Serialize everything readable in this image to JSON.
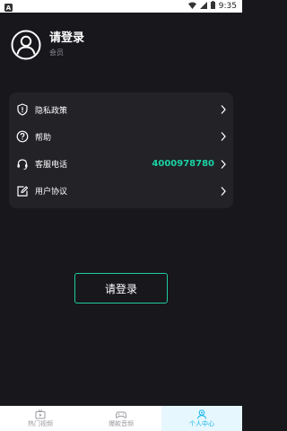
{
  "status_bar": {
    "time": "9:35",
    "app_icon": "a-icon",
    "icons": [
      "wifi-icon",
      "signal-icon",
      "battery-icon"
    ]
  },
  "profile": {
    "avatar_icon": "user-avatar-icon",
    "name": "请登录",
    "role": "会员"
  },
  "menu": [
    {
      "icon": "shield-icon",
      "label": "隐私政策",
      "value": ""
    },
    {
      "icon": "help-icon",
      "label": "帮助",
      "value": ""
    },
    {
      "icon": "headset-icon",
      "label": "客服电话",
      "value": "4000978780"
    },
    {
      "icon": "edit-icon",
      "label": "用户协议",
      "value": ""
    }
  ],
  "login_button": {
    "label": "请登录"
  },
  "tabs": [
    {
      "icon": "tv-icon",
      "label": "热门视频",
      "active": false
    },
    {
      "icon": "gamepad-icon",
      "label": "爆款音频",
      "active": false
    },
    {
      "icon": "person-icon",
      "label": "个人中心",
      "active": true
    }
  ],
  "colors": {
    "background": "#18171c",
    "card": "#222227",
    "accent": "#19d2a3",
    "tab_active": "#14b6e8"
  }
}
